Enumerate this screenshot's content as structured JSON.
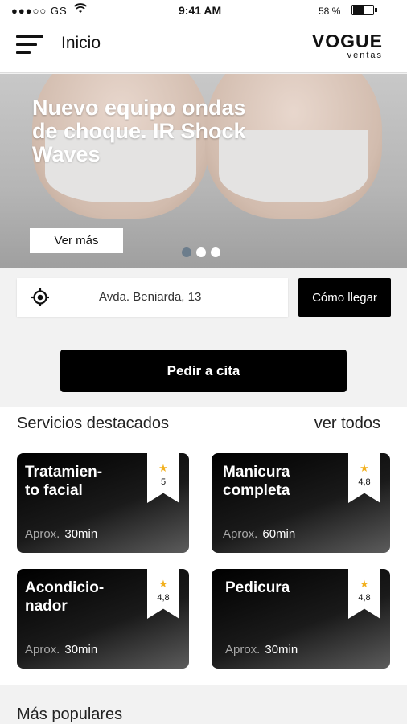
{
  "status": {
    "carrier": "●●●○○ GS",
    "time": "9:41 AM",
    "battery": "58 %",
    "battery_level": 0.58
  },
  "header": {
    "menu_icon": "hamburger-icon",
    "title": "Inicio",
    "logo_main": "VOGUE",
    "logo_sub": "ventas"
  },
  "hero": {
    "title": "Nuevo equipo ondas de choque. IR Shock Waves",
    "button_label": "Ver más",
    "slides": 3,
    "active_slide": 1
  },
  "location": {
    "icon": "location-target-icon",
    "address": "Avda. Beniarda, 13",
    "directions_label": "Cómo llegar"
  },
  "appointment": {
    "label": "Pedir a cita"
  },
  "services": {
    "title": "Servicios destacados",
    "see_all": "ver todos",
    "items": [
      {
        "name": "Tratamien-\nto facial",
        "rating": "5",
        "approx_label": "Aprox.",
        "duration": "30min"
      },
      {
        "name": "Manicura\ncompleta",
        "rating": "4,8",
        "approx_label": "Aprox.",
        "duration": "60min"
      },
      {
        "name": "Acondicio-\nnador",
        "rating": "4,8",
        "approx_label": "Aprox.",
        "duration": "30min"
      },
      {
        "name": "Pedicura",
        "rating": "4,8",
        "approx_label": "Aprox.",
        "duration": "30min"
      }
    ]
  },
  "popular": {
    "title": "Más populares"
  },
  "colors": {
    "accent": "#000000",
    "star": "#f2b01e",
    "active_dot": "#6c7d8c"
  }
}
